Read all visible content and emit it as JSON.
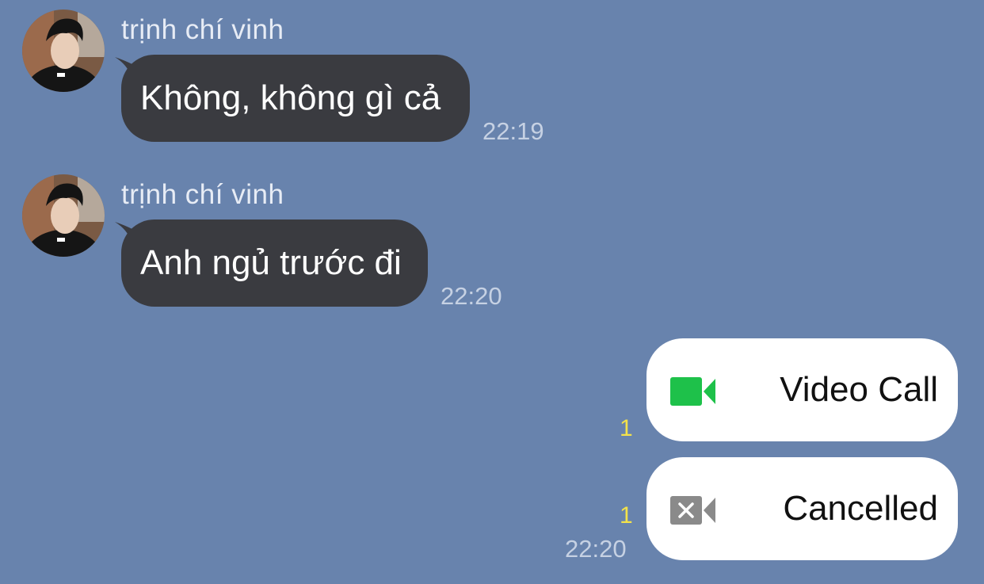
{
  "messages": [
    {
      "sender": "trịnh chí vinh",
      "text": "Không, không gì cả",
      "time": "22:19"
    },
    {
      "sender": "trịnh chí vinh",
      "text": "Anh ngủ trước đi",
      "time": "22:20"
    }
  ],
  "calls": [
    {
      "label": "Video Call",
      "icon": "video-camera-icon",
      "read_count": "1"
    },
    {
      "label": "Cancelled",
      "icon": "video-cancelled-icon",
      "read_count": "1",
      "time": "22:20"
    }
  ],
  "colors": {
    "background": "#6883ad",
    "incoming_bubble": "#3a3b40",
    "call_card": "#ffffff",
    "video_icon": "#1ec14a",
    "cancelled_icon": "#8a8a8a",
    "read_count": "#f3e24a"
  }
}
